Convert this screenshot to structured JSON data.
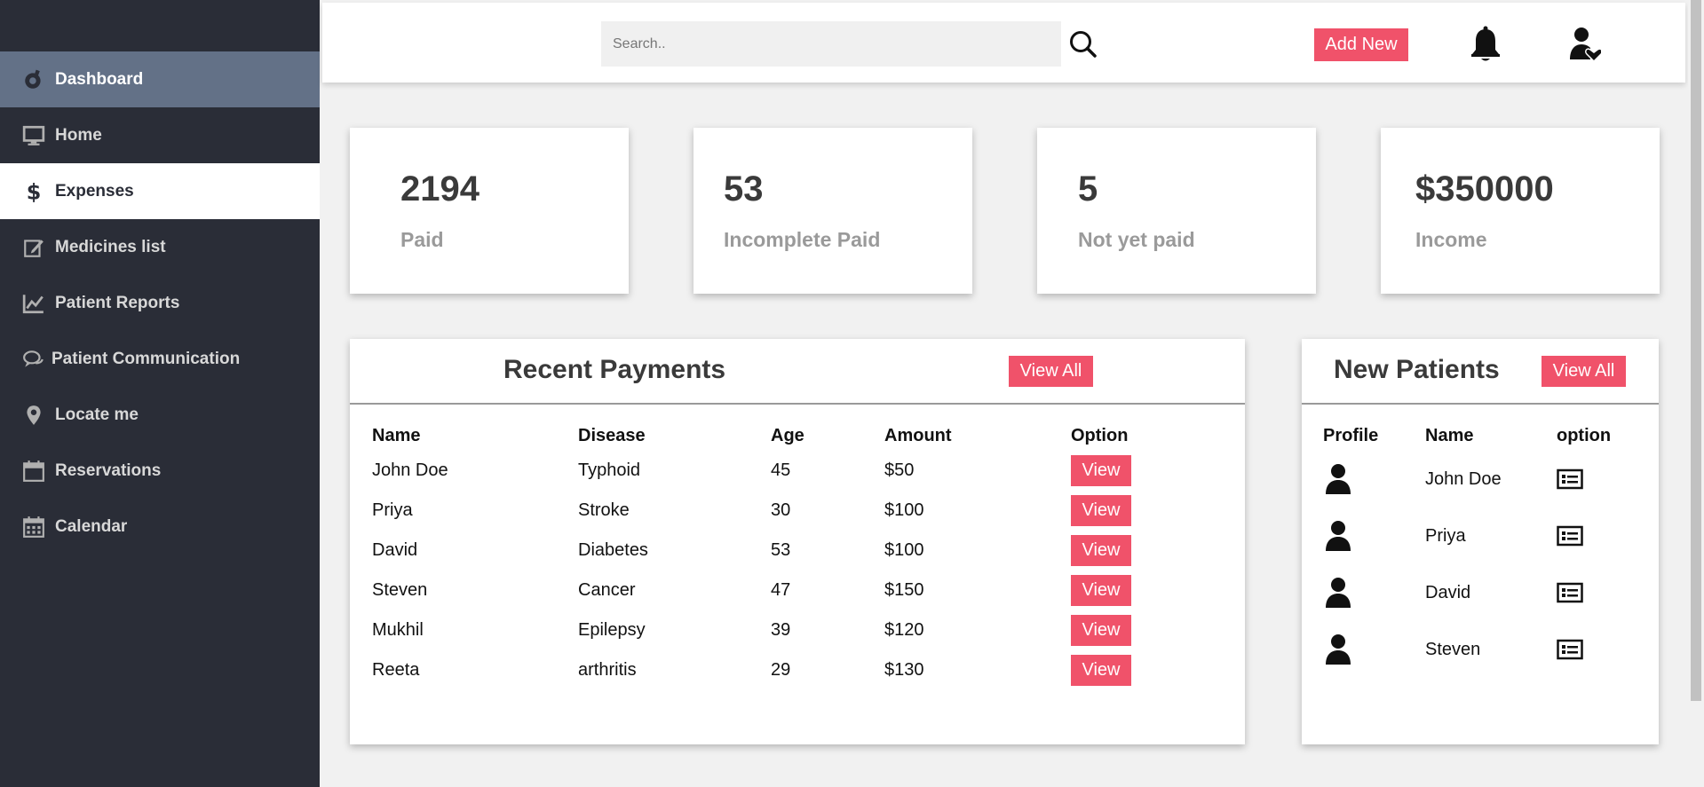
{
  "sidebar": {
    "items": [
      {
        "label": "Dashboard",
        "icon": "dashboard-icon"
      },
      {
        "label": "Home",
        "icon": "monitor-icon"
      },
      {
        "label": "Expenses",
        "icon": "dollar-icon"
      },
      {
        "label": "Medicines list",
        "icon": "edit-icon"
      },
      {
        "label": "Patient Reports",
        "icon": "line-chart-icon"
      },
      {
        "label": "Patient Communication",
        "icon": "chat-icon"
      },
      {
        "label": "Locate me",
        "icon": "map-pin-icon"
      },
      {
        "label": "Reservations",
        "icon": "calendar-icon"
      },
      {
        "label": "Calendar",
        "icon": "calendar-grid-icon"
      }
    ],
    "active": "Expenses"
  },
  "topbar": {
    "search_placeholder": "Search..",
    "add_new_label": "Add New"
  },
  "stats": [
    {
      "value": "2194",
      "label": "Paid"
    },
    {
      "value": "53",
      "label": "Incomplete Paid"
    },
    {
      "value": "5",
      "label": "Not yet paid"
    },
    {
      "value": "$350000",
      "label": "Income"
    }
  ],
  "recent_payments": {
    "title": "Recent Payments",
    "view_all_label": "View All",
    "columns": [
      "Name",
      "Disease",
      "Age",
      "Amount",
      "Option"
    ],
    "view_label": "View",
    "rows": [
      {
        "name": "John Doe",
        "disease": "Typhoid",
        "age": "45",
        "amount": "$50"
      },
      {
        "name": "Priya",
        "disease": "Stroke",
        "age": "30",
        "amount": "$100"
      },
      {
        "name": "David",
        "disease": "Diabetes",
        "age": "53",
        "amount": "$100"
      },
      {
        "name": "Steven",
        "disease": "Cancer",
        "age": "47",
        "amount": "$150"
      },
      {
        "name": "Mukhil",
        "disease": "Epilepsy",
        "age": "39",
        "amount": "$120"
      },
      {
        "name": "Reeta",
        "disease": "arthritis",
        "age": "29",
        "amount": "$130"
      }
    ]
  },
  "new_patients": {
    "title": "New Patients",
    "view_all_label": "View All",
    "columns": [
      "Profile",
      "Name",
      "option"
    ],
    "rows": [
      {
        "name": "John Doe"
      },
      {
        "name": "Priya"
      },
      {
        "name": "David"
      },
      {
        "name": "Steven"
      }
    ]
  },
  "colors": {
    "sidebar_bg": "#2a2d37",
    "sidebar_dashboard_bg": "#637187",
    "accent": "#f0526a",
    "page_bg": "#f1f1f1"
  }
}
